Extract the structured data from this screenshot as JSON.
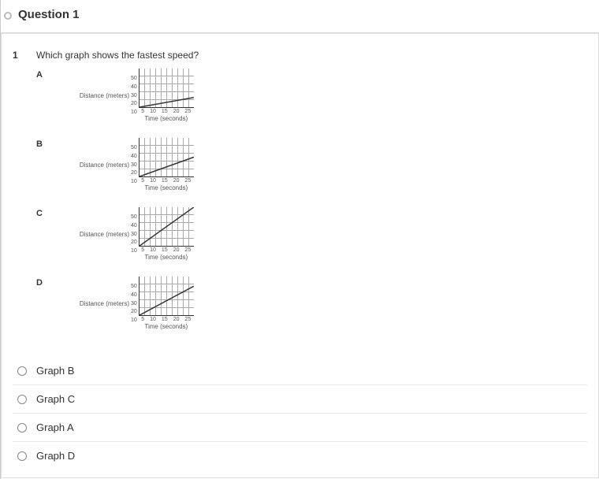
{
  "header": {
    "title": "Question 1"
  },
  "question": {
    "number": "1",
    "text": "Which graph shows the fastest speed?"
  },
  "axis": {
    "ylabel": "Distance (meters)",
    "xlabel": "Time (seconds)",
    "yticks": [
      "50",
      "40",
      "30",
      "20",
      "10"
    ],
    "xticks": [
      "5",
      "10",
      "15",
      "20",
      "25"
    ]
  },
  "graphs": {
    "a": {
      "letter": "A"
    },
    "b": {
      "letter": "B"
    },
    "c": {
      "letter": "C"
    },
    "d": {
      "letter": "D"
    }
  },
  "chart_data": [
    {
      "name": "A",
      "type": "line",
      "xlabel": "Time (seconds)",
      "ylabel": "Distance (meters)",
      "xlim": [
        0,
        25
      ],
      "ylim": [
        0,
        50
      ],
      "x": [
        0,
        25
      ],
      "y": [
        0,
        12.5
      ]
    },
    {
      "name": "B",
      "type": "line",
      "xlabel": "Time (seconds)",
      "ylabel": "Distance (meters)",
      "xlim": [
        0,
        25
      ],
      "ylim": [
        0,
        50
      ],
      "x": [
        0,
        25
      ],
      "y": [
        0,
        25
      ]
    },
    {
      "name": "C",
      "type": "line",
      "xlabel": "Time (seconds)",
      "ylabel": "Distance (meters)",
      "xlim": [
        0,
        25
      ],
      "ylim": [
        0,
        50
      ],
      "x": [
        0,
        25
      ],
      "y": [
        0,
        50
      ]
    },
    {
      "name": "D",
      "type": "line",
      "xlabel": "Time (seconds)",
      "ylabel": "Distance (meters)",
      "xlim": [
        0,
        25
      ],
      "ylim": [
        0,
        50
      ],
      "x": [
        0,
        25
      ],
      "y": [
        0,
        37.5
      ]
    }
  ],
  "options": {
    "opt1": "Graph B",
    "opt2": "Graph C",
    "opt3": "Graph A",
    "opt4": "Graph D"
  }
}
